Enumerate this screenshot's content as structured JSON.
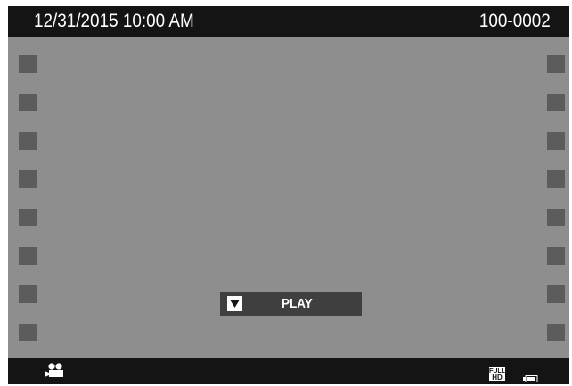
{
  "header": {
    "datetime": "12/31/2015 10:00 AM",
    "file_number": "100-0002"
  },
  "playback": {
    "play_label": "PLAY",
    "key_icon": "down-arrow-key-icon"
  },
  "status_bar": {
    "mode_icon": "movie-camera-icon",
    "quality_icon": "full-hd-icon",
    "quality_text_top": "FULL",
    "quality_text_bottom": "HD",
    "battery_icon": "battery-icon"
  },
  "colors": {
    "screen_background": "#8e8e8e",
    "bar_background": "#141414",
    "sprocket": "#5c5c5c",
    "play_button": "#3f3f3f",
    "text": "#ffffff"
  }
}
